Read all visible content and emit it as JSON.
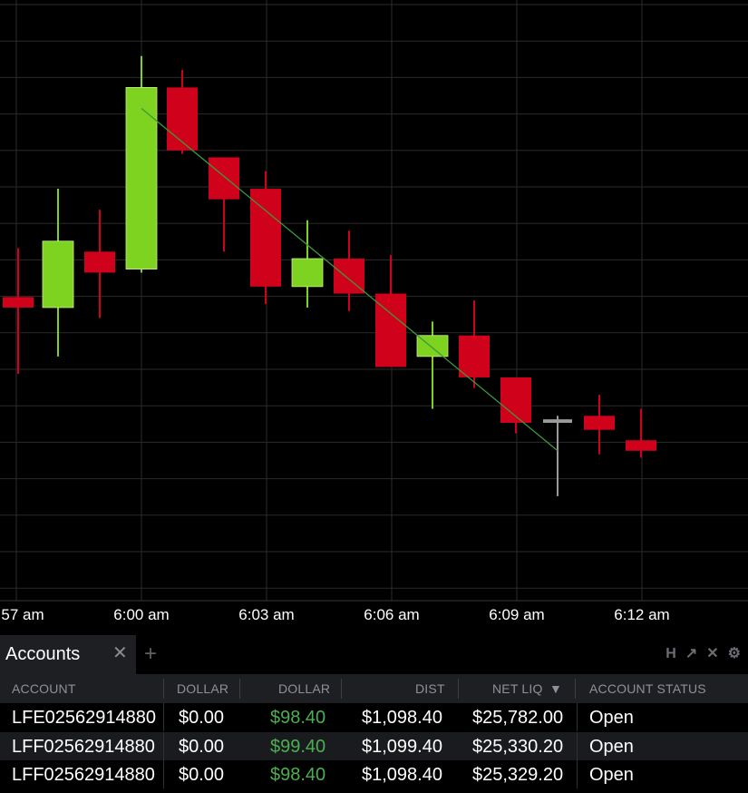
{
  "colors": {
    "background": "#000000",
    "grid": "#2b2b2b",
    "up": "#7ed321",
    "down": "#d0021b",
    "neutral": "#9b9b9b",
    "trend": "#3a9a3a",
    "positive_text": "#4caf50"
  },
  "chart_data": {
    "type": "candlestick",
    "x_tick_labels": [
      "57 am",
      "6:00 am",
      "6:03 am",
      "6:06 am",
      "6:09 am",
      "6:12 am"
    ],
    "grid": true,
    "candles": [
      {
        "time": "5:59",
        "open": 7.6,
        "close": 7.3,
        "high": 9.0,
        "low": 5.4,
        "dir": "down"
      },
      {
        "time": "5:59",
        "open": 7.3,
        "close": 9.2,
        "high": 10.7,
        "low": 5.9,
        "dir": "up"
      },
      {
        "time": "6:00",
        "open": 8.9,
        "close": 8.3,
        "high": 10.1,
        "low": 7.0,
        "dir": "down"
      },
      {
        "time": "6:00",
        "open": 8.4,
        "close": 13.6,
        "high": 14.5,
        "low": 8.3,
        "dir": "up"
      },
      {
        "time": "6:01",
        "open": 13.6,
        "close": 11.8,
        "high": 14.1,
        "low": 11.7,
        "dir": "down"
      },
      {
        "time": "6:02",
        "open": 11.6,
        "close": 10.4,
        "high": 10.4,
        "low": 8.9,
        "dir": "down"
      },
      {
        "time": "6:03",
        "open": 10.7,
        "close": 7.9,
        "high": 11.2,
        "low": 7.4,
        "dir": "down"
      },
      {
        "time": "6:04",
        "open": 7.9,
        "close": 8.7,
        "high": 9.8,
        "low": 7.3,
        "dir": "up"
      },
      {
        "time": "6:05",
        "open": 8.7,
        "close": 7.7,
        "high": 9.5,
        "low": 7.2,
        "dir": "down"
      },
      {
        "time": "6:06",
        "open": 7.7,
        "close": 5.6,
        "high": 8.8,
        "low": 5.6,
        "dir": "down"
      },
      {
        "time": "6:07",
        "open": 5.9,
        "close": 6.5,
        "high": 6.9,
        "low": 4.4,
        "dir": "up"
      },
      {
        "time": "6:08",
        "open": 6.5,
        "close": 5.3,
        "high": 7.5,
        "low": 5.0,
        "dir": "down"
      },
      {
        "time": "6:09",
        "open": 5.3,
        "close": 4.0,
        "high": 4.0,
        "low": 3.7,
        "dir": "down"
      },
      {
        "time": "6:10",
        "open": 4.0,
        "close": 4.1,
        "high": 4.2,
        "low": 1.9,
        "dir": "neutral"
      },
      {
        "time": "6:11",
        "open": 4.2,
        "close": 3.8,
        "high": 4.8,
        "low": 3.1,
        "dir": "down"
      },
      {
        "time": "6:12",
        "open": 3.5,
        "close": 3.2,
        "high": 4.4,
        "low": 3.0,
        "dir": "down"
      }
    ],
    "trendline": {
      "from": {
        "time": "6:00",
        "value": 13.0
      },
      "to": {
        "time": "6:10",
        "value": 3.2
      }
    }
  },
  "accounts_panel": {
    "tab_label": "Accounts",
    "tab_close": "✕",
    "tab_add": "+",
    "tools": [
      "H",
      "↗",
      "✕",
      "⚙"
    ],
    "columns": [
      "ACCOUNT",
      "DOLLAR",
      "DOLLAR",
      "DIST",
      "NET LIQ",
      "ACCOUNT STATUS"
    ],
    "sort_indicator": "▼",
    "rows": [
      {
        "account": "LFE02562914880",
        "dollar1": "$0.00",
        "dollar2": "$98.40",
        "dist": "$1,098.40",
        "net_liq": "$25,782.00",
        "status": "Open"
      },
      {
        "account": "LFF02562914880",
        "dollar1": "$0.00",
        "dollar2": "$99.40",
        "dist": "$1,099.40",
        "net_liq": "$25,330.20",
        "status": "Open"
      },
      {
        "account": "LFF02562914880",
        "dollar1": "$0.00",
        "dollar2": "$98.40",
        "dist": "$1,098.40",
        "net_liq": "$25,329.20",
        "status": "Open"
      }
    ]
  }
}
